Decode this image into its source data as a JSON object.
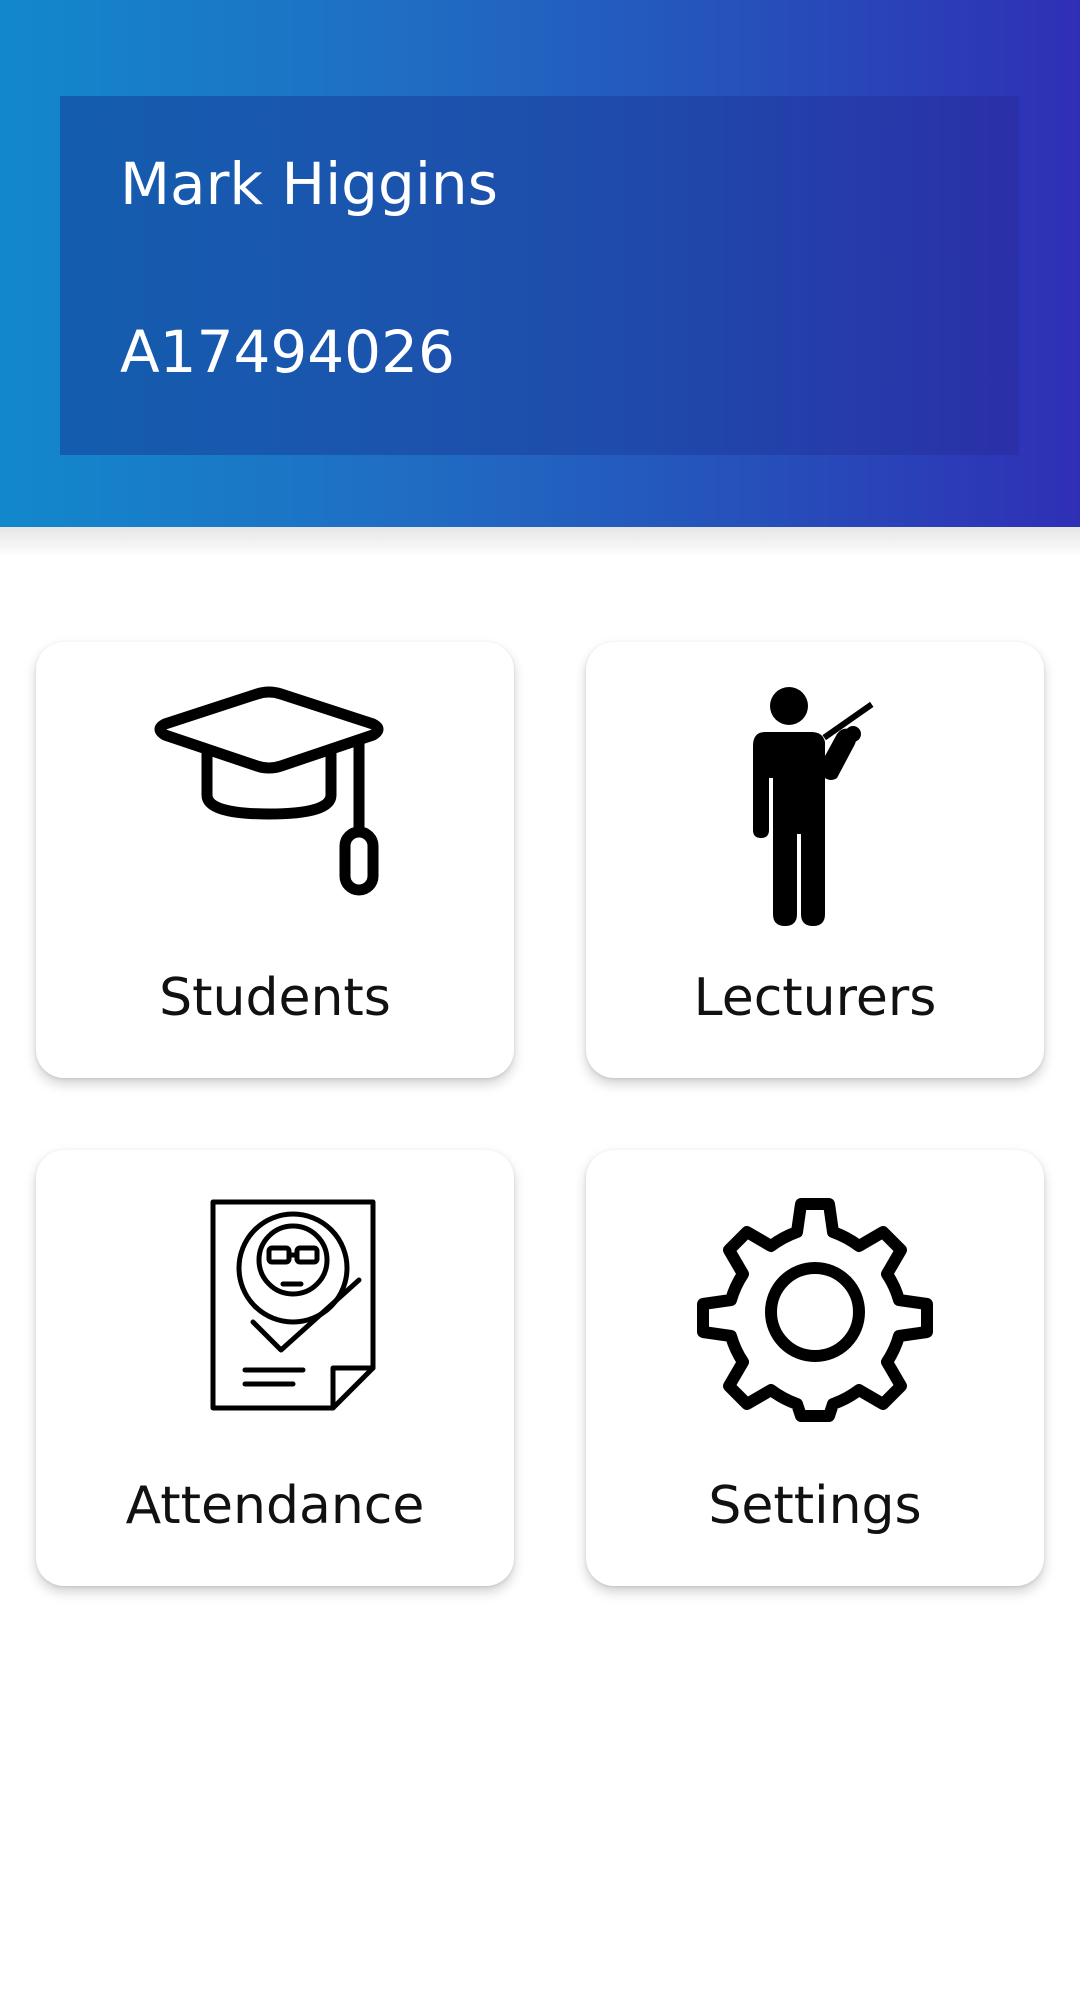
{
  "profile": {
    "name": "Mark Higgins",
    "id": "A17494026"
  },
  "menu": {
    "tiles": [
      {
        "label": "Students",
        "icon": "graduation-cap-icon"
      },
      {
        "label": "Lecturers",
        "icon": "lecturer-pointer-icon"
      },
      {
        "label": "Attendance",
        "icon": "attendance-document-icon"
      },
      {
        "label": "Settings",
        "icon": "gear-icon"
      }
    ]
  },
  "colors": {
    "header_start": "#1288cc",
    "header_end": "#2f2fb6",
    "text_on_header": "#ffffff",
    "tile_background": "#ffffff"
  }
}
